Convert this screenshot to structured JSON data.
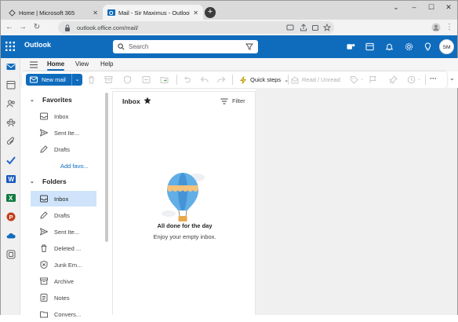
{
  "browser": {
    "tabs": [
      {
        "title": "Home | Microsoft 365",
        "close": "✕"
      },
      {
        "title": "Mail - Sir Maximus - Outlook",
        "close": "✕"
      }
    ],
    "new_tab": "+",
    "window_controls": {
      "dropdown": "⌄",
      "minimize": "–",
      "maximize": "☐",
      "close": "✕"
    },
    "nav": {
      "back": "←",
      "forward": "→",
      "reload": "↻"
    },
    "url": "outlook.office.com/mail/"
  },
  "outlook": {
    "brand": "Outlook",
    "search_placeholder": "Search",
    "avatar_initials": "SM",
    "ribbon_tabs": {
      "home": "Home",
      "view": "View",
      "help": "Help"
    },
    "toolbar": {
      "new_mail": "New mail",
      "quick_steps": "Quick steps",
      "read_unread": "Read / Unread",
      "more": "···"
    },
    "folder_pane": {
      "favorites_header": "Favorites",
      "favorites": [
        {
          "label": "Inbox",
          "icon": "inbox-icon"
        },
        {
          "label": "Sent Ite...",
          "icon": "send-icon"
        },
        {
          "label": "Drafts",
          "icon": "drafts-icon"
        }
      ],
      "add_favorite": "Add favo...",
      "folders_header": "Folders",
      "folders": [
        {
          "label": "Inbox",
          "icon": "inbox-icon",
          "selected": true
        },
        {
          "label": "Drafts",
          "icon": "drafts-icon"
        },
        {
          "label": "Sent Ite...",
          "icon": "send-icon"
        },
        {
          "label": "Deleted ...",
          "icon": "trash-icon"
        },
        {
          "label": "Junk Em...",
          "icon": "junk-icon"
        },
        {
          "label": "Archive",
          "icon": "archive-icon"
        },
        {
          "label": "Notes",
          "icon": "notes-icon"
        },
        {
          "label": "Convers...",
          "icon": "folder-icon"
        }
      ]
    },
    "message_list": {
      "title": "Inbox",
      "filter": "Filter",
      "empty_title": "All done for the day",
      "empty_subtitle": "Enjoy your empty inbox."
    }
  },
  "colors": {
    "brand_blue": "#0f6cbd",
    "selected_folder": "#cfe4fa",
    "reading_pane": "#f0f0f0"
  }
}
